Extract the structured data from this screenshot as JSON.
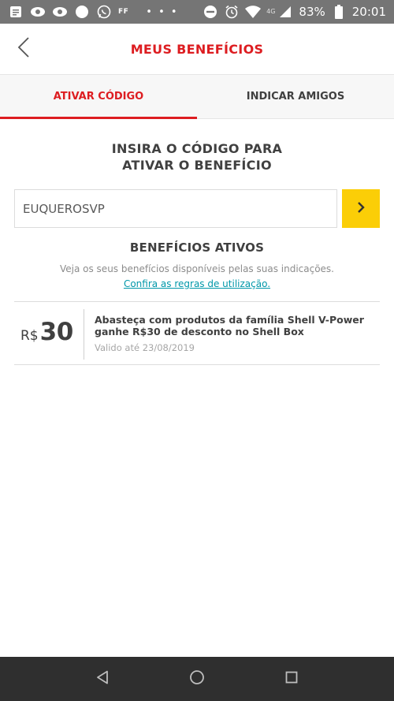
{
  "status_bar": {
    "ff_text": "FF",
    "dots": "• • •",
    "network": "4G",
    "battery": "83%",
    "time": "20:01"
  },
  "header": {
    "title": "MEUS BENEFÍCIOS",
    "back_icon": "chevron-left-icon",
    "title_color": "#dd1d21"
  },
  "tabs": [
    {
      "label": "ATIVAR CÓDIGO",
      "active": true
    },
    {
      "label": "INDICAR AMIGOS",
      "active": false
    }
  ],
  "code_section": {
    "title_line1": "INSIRA O CÓDIGO PARA",
    "title_line2": "ATIVAR O BENEFÍCIO",
    "input_value": "EUQUEROSVP",
    "submit_icon": "chevron-right-icon",
    "submit_color": "#fbce07"
  },
  "active_benefits": {
    "title": "BENEFÍCIOS ATIVOS",
    "description": "Veja os seus benefícios disponíveis pelas suas indicações.",
    "rules_link": "Confira as regras de utilização.",
    "items": [
      {
        "currency": "R$",
        "amount": "30",
        "text": "Abasteça com produtos da família Shell V-Power ganhe R$30 de desconto no Shell Box",
        "validity": "Valido até 23/08/2019"
      }
    ]
  },
  "nav_bar": {
    "back_icon": "triangle-back-icon",
    "home_icon": "circle-home-icon",
    "recents_icon": "square-recents-icon"
  }
}
